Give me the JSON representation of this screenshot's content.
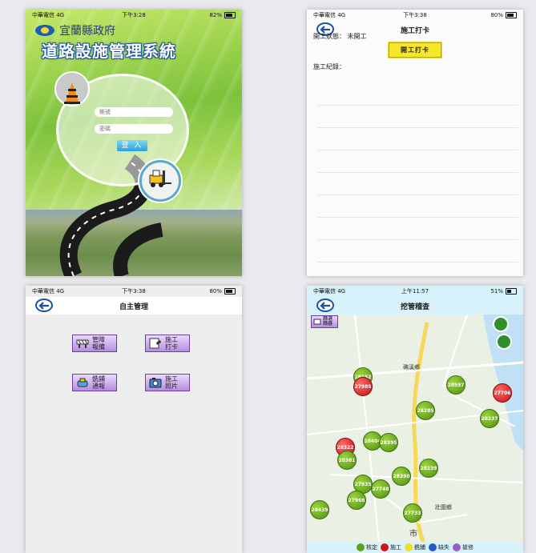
{
  "login_screen": {
    "status": {
      "carrier": "中華電信 4G",
      "time": "下午3:28",
      "battery": "82%"
    },
    "agency": "宜蘭縣政府",
    "app_title": "道路設施管理系統",
    "username_placeholder": "帳號",
    "password_placeholder": "密碼",
    "login_label": "登 入"
  },
  "clock_in_screen": {
    "status": {
      "carrier": "中華電信 4G",
      "time": "下午3:38",
      "battery": "80%"
    },
    "title": "施工打卡",
    "state_label": "開工狀態：",
    "state_value": "未開工",
    "clock_button": "開工打卡",
    "records_label": "施工紀錄："
  },
  "self_manage_screen": {
    "status": {
      "carrier": "中華電信 4G",
      "time": "下午3:38",
      "battery": "80%"
    },
    "title": "自主管理",
    "tiles": [
      {
        "line1": "管障",
        "line2": "報備",
        "icon": "barrier-icon"
      },
      {
        "line1": "施工",
        "line2": "打卡",
        "icon": "clock-in-icon"
      },
      {
        "line1": "銑鋪",
        "line2": "通報",
        "icon": "paving-icon"
      },
      {
        "line1": "施工",
        "line2": "照片",
        "icon": "camera-icon"
      }
    ]
  },
  "map_screen": {
    "status": {
      "carrier": "中華電信 4G",
      "time": "上午11:57",
      "battery": "51%"
    },
    "title": "挖管稽查",
    "filter_label_1": "篩選",
    "filter_label_2": "篩器",
    "place_labels": [
      "礁溪鄉",
      "壯圍鄉",
      "市"
    ],
    "markers": [
      "28152",
      "27985",
      "28597",
      "27706",
      "28285",
      "28237",
      "28404",
      "28395",
      "28322",
      "28381",
      "28390",
      "28239",
      "27935",
      "27748",
      "27966",
      "28439",
      "27733"
    ],
    "legend": [
      {
        "label": "核定",
        "color": "#5aa619"
      },
      {
        "label": "施工",
        "color": "#d41414"
      },
      {
        "label": "銑鋪",
        "color": "#f2df1f"
      },
      {
        "label": "缺失",
        "color": "#1d5fc4"
      },
      {
        "label": "搶修",
        "color": "#9a5bc9"
      }
    ]
  }
}
